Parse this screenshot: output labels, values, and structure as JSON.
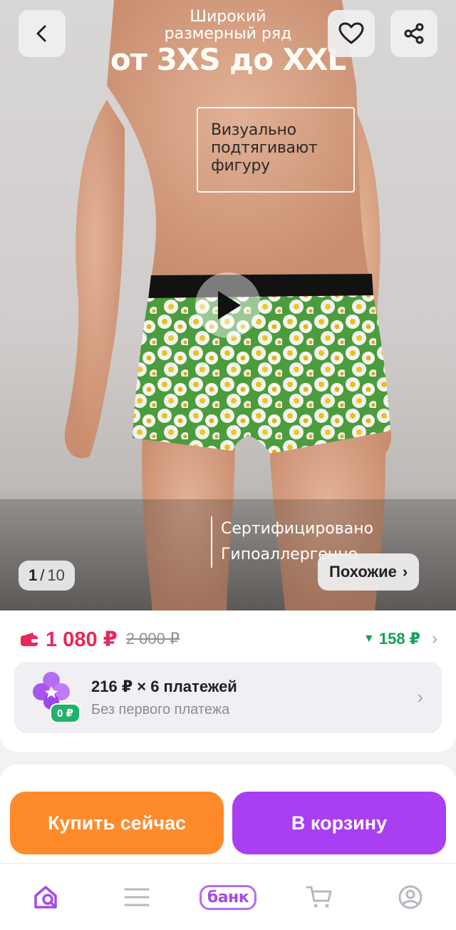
{
  "gallery": {
    "promo_line1": "Широкий",
    "promo_line2": "размерный ряд",
    "promo_big": "от 3XS до XXL",
    "visual_lines": [
      "Визуально",
      "подтягивают",
      "фигуру"
    ],
    "cert_lines": [
      "Сертифицировано",
      "Гипоаллергенно"
    ],
    "counter_current": "1",
    "counter_separator": "/",
    "counter_total": "10",
    "similar_label": "Похожие",
    "similar_chevron": "›",
    "icons": {
      "back": "chevron-left-icon",
      "favorite": "heart-icon",
      "share": "share-icon",
      "play": "play-icon"
    }
  },
  "price": {
    "current": "1 080 ₽",
    "old": "2 000 ₽",
    "cashback": "158 ₽",
    "cashback_arrow": "▼",
    "chevron": "›",
    "current_color": "#e8275a",
    "cashback_color": "#15a05a"
  },
  "split": {
    "title": "216 ₽ × 6 платежей",
    "subtitle": "Без первого платежа",
    "badge": "0 ₽",
    "chevron": "›"
  },
  "actions": {
    "buy_label": "Купить сейчас",
    "cart_label": "В корзину",
    "buy_color": "#ff8a2a",
    "cart_color": "#a93ef2"
  },
  "nav": {
    "bank_label": "банк",
    "items": [
      "home-search-icon",
      "menu-icon",
      "bank-icon",
      "cart-icon",
      "profile-icon"
    ]
  }
}
